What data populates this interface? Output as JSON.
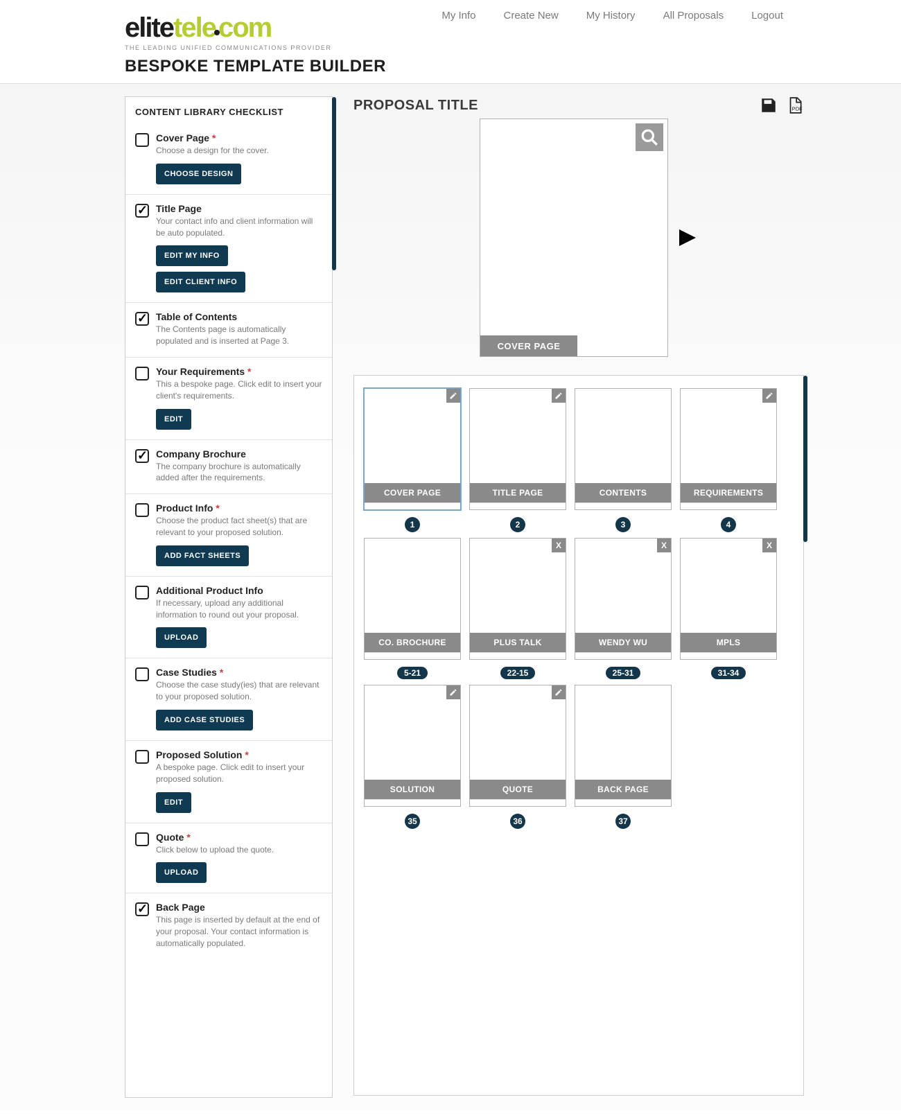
{
  "nav": [
    "My Info",
    "Create New",
    "My History",
    "All Proposals",
    "Logout"
  ],
  "brand": {
    "tagline": "THE LEADING UNIFIED COMMUNICATIONS PROVIDER",
    "page_sub": "BESPOKE TEMPLATE BUILDER"
  },
  "sidebar": {
    "heading": "CONTENT LIBRARY CHECKLIST",
    "items": [
      {
        "title": "Cover Page",
        "required": true,
        "checked": false,
        "desc": "Choose a design for the cover.",
        "buttons": [
          "CHOOSE DESIGN"
        ]
      },
      {
        "title": "Title Page",
        "required": false,
        "checked": true,
        "desc": "Your contact info and client information will be auto populated.",
        "buttons": [
          "EDIT MY INFO",
          "EDIT CLIENT INFO"
        ]
      },
      {
        "title": "Table of Contents",
        "required": false,
        "checked": true,
        "desc": "The Contents page is automatically populated and is inserted at Page 3.",
        "buttons": []
      },
      {
        "title": "Your Requirements",
        "required": true,
        "checked": false,
        "desc": "This a bespoke page. Click edit to insert your client's requirements.",
        "buttons": [
          "EDIT"
        ]
      },
      {
        "title": "Company Brochure",
        "required": false,
        "checked": true,
        "desc": "The company brochure is automatically added after the requirements.",
        "buttons": []
      },
      {
        "title": "Product Info",
        "required": true,
        "checked": false,
        "desc": "Choose the product fact sheet(s) that are relevant to your proposed solution.",
        "buttons": [
          "ADD FACT SHEETS"
        ]
      },
      {
        "title": "Additional Product Info",
        "required": false,
        "checked": false,
        "desc": "If necessary, upload any additional information to round out your proposal.",
        "buttons": [
          "UPLOAD"
        ]
      },
      {
        "title": "Case Studies",
        "required": true,
        "checked": false,
        "desc": "Choose the case study(ies) that are relevant to your proposed solution.",
        "buttons": [
          "ADD CASE STUDIES"
        ]
      },
      {
        "title": "Proposed Solution",
        "required": true,
        "checked": false,
        "desc": "A bespoke page. Click edit to insert your proposed solution.",
        "buttons": [
          "EDIT"
        ]
      },
      {
        "title": "Quote",
        "required": true,
        "checked": false,
        "desc": "Click below to upload the quote.",
        "buttons": [
          "UPLOAD"
        ]
      },
      {
        "title": "Back Page",
        "required": false,
        "checked": true,
        "desc": "This page is inserted by default at the end of your proposal. Your contact information is automatically populated.",
        "buttons": []
      }
    ]
  },
  "main": {
    "title": "PROPOSAL TITLE",
    "preview_label": "COVER PAGE",
    "rows": [
      [
        {
          "label": "COVER PAGE",
          "badge": "1",
          "badge_type": "num",
          "corner": "edit",
          "selected": true
        },
        {
          "label": "TITLE PAGE",
          "badge": "2",
          "badge_type": "num",
          "corner": "edit"
        },
        {
          "label": "CONTENTS",
          "badge": "3",
          "badge_type": "num"
        },
        {
          "label": "REQUIREMENTS",
          "badge": "4",
          "badge_type": "num",
          "corner": "edit"
        }
      ],
      [
        {
          "label": "CO. BROCHURE",
          "badge": "5-21",
          "badge_type": "pill"
        },
        {
          "label": "PLUS TALK",
          "badge": "22-15",
          "badge_type": "pill",
          "corner": "close"
        },
        {
          "label": "WENDY WU",
          "badge": "25-31",
          "badge_type": "pill",
          "corner": "close"
        },
        {
          "label": "MPLS",
          "badge": "31-34",
          "badge_type": "pill",
          "corner": "close"
        }
      ],
      [
        {
          "label": "SOLUTION",
          "badge": "35",
          "badge_type": "num",
          "corner": "edit"
        },
        {
          "label": "QUOTE",
          "badge": "36",
          "badge_type": "num",
          "corner": "edit"
        },
        {
          "label": "BACK PAGE",
          "badge": "37",
          "badge_type": "num"
        }
      ]
    ]
  }
}
